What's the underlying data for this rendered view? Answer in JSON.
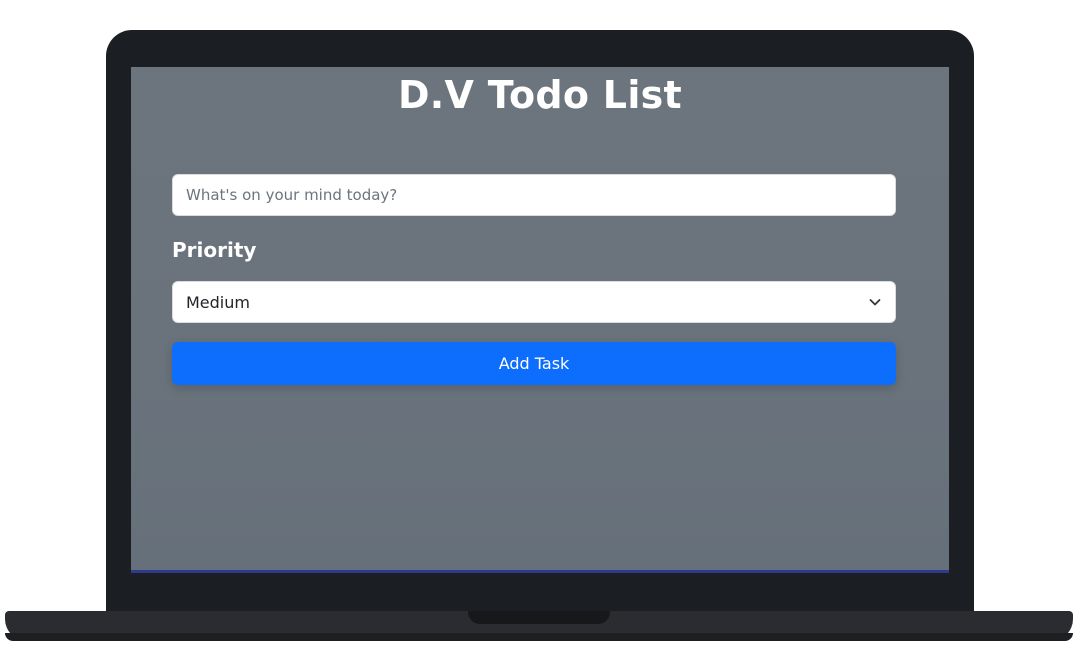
{
  "app": {
    "title": "D.V Todo List"
  },
  "form": {
    "task_input": {
      "value": "",
      "placeholder": "What's on your mind today?"
    },
    "priority": {
      "label": "Priority",
      "selected": "Medium"
    },
    "add_button_label": "Add Task"
  },
  "icons": {
    "select_chevron": "chevron-down-icon"
  },
  "colors": {
    "screen_background": "#6c747d",
    "laptop_bezel": "#1b1f24",
    "primary_button": "#0d6efd",
    "title_text": "#ffffff"
  }
}
